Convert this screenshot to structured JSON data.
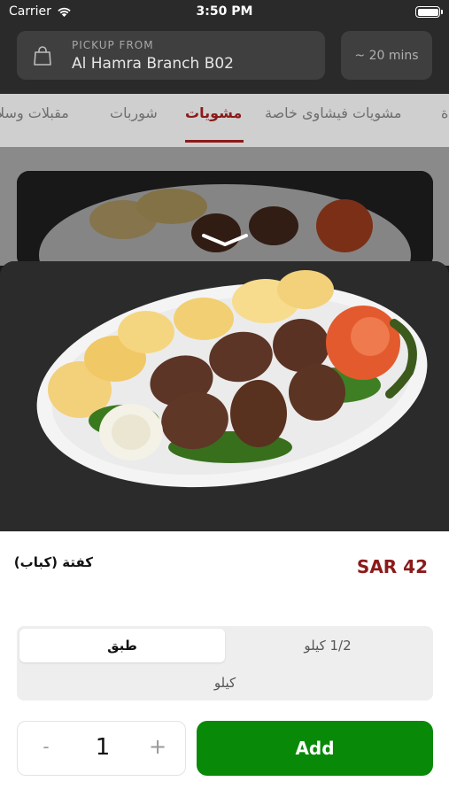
{
  "status_bar": {
    "carrier": "Carrier",
    "time": "3:50 PM"
  },
  "header": {
    "pickup_label": "PICKUP FROM",
    "branch": "Al Hamra Branch B02",
    "eta": "~ 20 mins"
  },
  "tabs": [
    {
      "label": "ة",
      "active": false
    },
    {
      "label": "مشويات فيشاوى خاصة",
      "active": false
    },
    {
      "label": "مشويات",
      "active": true
    },
    {
      "label": "شوربات",
      "active": false
    },
    {
      "label": "مقبلات وسلا",
      "active": false
    }
  ],
  "item": {
    "name": "كفتة (كباب)",
    "price": "SAR 42"
  },
  "options": {
    "selected": "طبق",
    "half_kilo": "1/2 كيلو",
    "kilo": "كيلو"
  },
  "stepper": {
    "minus": "-",
    "value": "1",
    "plus": "+"
  },
  "add_button": "Add",
  "colors": {
    "accent": "#8b1a1a",
    "add": "#088a08"
  }
}
